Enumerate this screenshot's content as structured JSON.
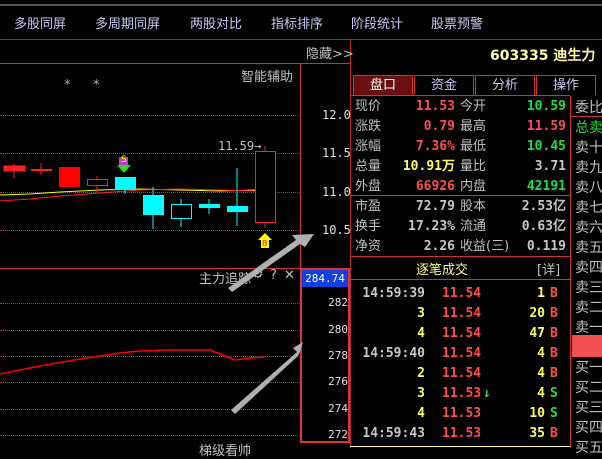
{
  "menu": [
    "多股同屏",
    "多周期同屏",
    "两股对比",
    "指标排序",
    "阶段统计",
    "股票预警"
  ],
  "hide_label": "隐藏>>",
  "chart": {
    "indicator": "智能辅助",
    "axis": [
      "12.0",
      "11.5",
      "11.0",
      "10.5"
    ],
    "high_label": "11.59→",
    "sell_marker": "S",
    "buy_marker": "B",
    "stars": "*"
  },
  "subchart": {
    "title": "主力追踪",
    "current": "284.74",
    "axis": [
      "282",
      "280",
      "278",
      "276",
      "274",
      "272"
    ],
    "gear": "⚙",
    "help": "?",
    "close": "✕",
    "next_title": "梯级看帅"
  },
  "stock": {
    "code": "603335",
    "name": "迪生力"
  },
  "tabs": [
    "盘口",
    "资金",
    "分析",
    "操作"
  ],
  "quote": [
    {
      "l1": "现价",
      "v1": "11.53",
      "l2": "今开",
      "v2": "10.59"
    },
    {
      "l1": "涨跌",
      "v1": "0.79",
      "l2": "最高",
      "v2": "11.59"
    },
    {
      "l1": "涨幅",
      "v1": "7.36%",
      "l2": "最低",
      "v2": "10.45"
    },
    {
      "l1": "总量",
      "v1": "10.91万",
      "l2": "量比",
      "v2": "3.71"
    },
    {
      "l1": "外盘",
      "v1": "66926",
      "l2": "内盘",
      "v2": "42191"
    },
    {
      "l1": "市盈",
      "v1": "72.79",
      "l2": "股本",
      "v2": "2.53亿"
    },
    {
      "l1": "换手",
      "v1": "17.23%",
      "l2": "流通",
      "v2": "0.63亿"
    },
    {
      "l1": "净资",
      "v1": "2.26",
      "l2": "收益(三)",
      "v2": "0.119"
    }
  ],
  "trades_title": "逐笔成交",
  "trades_detail": "[详]",
  "trades": [
    {
      "t": "14:59:39",
      "p": "11.54",
      "a": "",
      "v": "1",
      "s": "B"
    },
    {
      "t": "3",
      "p": "11.54",
      "a": "",
      "v": "20",
      "s": "B"
    },
    {
      "t": "4",
      "p": "11.54",
      "a": "",
      "v": "47",
      "s": "B"
    },
    {
      "t": "14:59:40",
      "p": "11.54",
      "a": "",
      "v": "4",
      "s": "B"
    },
    {
      "t": "2",
      "p": "11.54",
      "a": "",
      "v": "4",
      "s": "B"
    },
    {
      "t": "3",
      "p": "11.53",
      "a": "↓",
      "v": "4",
      "s": "S"
    },
    {
      "t": "4",
      "p": "11.53",
      "a": "",
      "v": "10",
      "s": "S"
    },
    {
      "t": "14:59:43",
      "p": "11.53",
      "a": "",
      "v": "35",
      "s": "B"
    }
  ],
  "side": {
    "ratio": "委比",
    "total_sell": "总卖",
    "sells": [
      "卖十",
      "卖九",
      "卖八",
      "卖七",
      "卖六",
      "卖五",
      "卖四",
      "卖三",
      "卖二",
      "卖一"
    ],
    "buys": [
      "买一",
      "买二",
      "买三",
      "买四",
      "买五"
    ]
  }
}
